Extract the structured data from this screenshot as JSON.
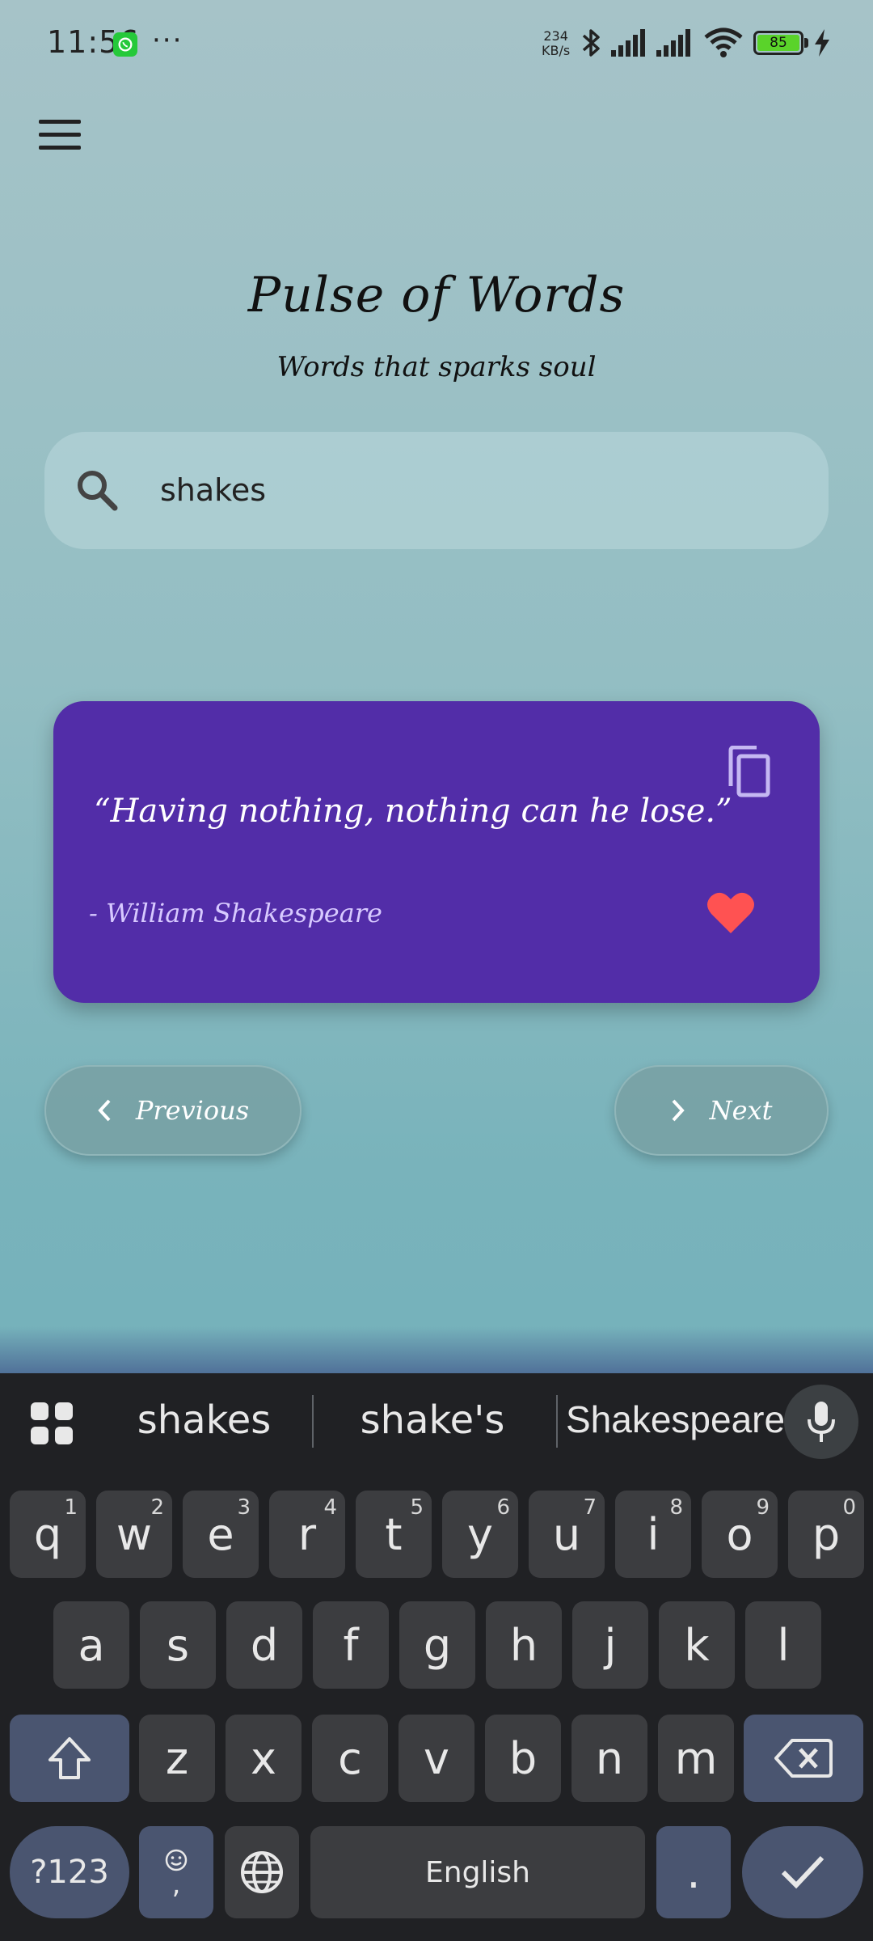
{
  "status_bar": {
    "time": "11:56",
    "net_speed_value": "234",
    "net_speed_unit": "KB/s",
    "battery": "85",
    "overflow": "···"
  },
  "app": {
    "title": "Pulse of Words",
    "subtitle": "Words that sparks soul"
  },
  "search": {
    "value": "shakes"
  },
  "quote": {
    "text": "“Having nothing, nothing can he lose.”",
    "author": "- William Shakespeare"
  },
  "nav": {
    "previous_label": "Previous",
    "next_label": "Next"
  },
  "keyboard": {
    "suggestions": [
      "shakes",
      "shake's",
      "Shakespeare"
    ],
    "row1": [
      {
        "k": "q",
        "s": "1"
      },
      {
        "k": "w",
        "s": "2"
      },
      {
        "k": "e",
        "s": "3"
      },
      {
        "k": "r",
        "s": "4"
      },
      {
        "k": "t",
        "s": "5"
      },
      {
        "k": "y",
        "s": "6"
      },
      {
        "k": "u",
        "s": "7"
      },
      {
        "k": "i",
        "s": "8"
      },
      {
        "k": "o",
        "s": "9"
      },
      {
        "k": "p",
        "s": "0"
      }
    ],
    "row2": [
      "a",
      "s",
      "d",
      "f",
      "g",
      "h",
      "j",
      "k",
      "l"
    ],
    "row3": [
      "z",
      "x",
      "c",
      "v",
      "b",
      "n",
      "m"
    ],
    "symbols_label": "?123",
    "emoji_comma": ",",
    "space_label": "English",
    "period_label": ".",
    "colors": {
      "background": "#202124",
      "key": "#3c3d40",
      "special_key": "#4a5570"
    }
  },
  "colors": {
    "card": "#522da8",
    "heart": "#ff5252",
    "author": "#d7c9ff"
  }
}
